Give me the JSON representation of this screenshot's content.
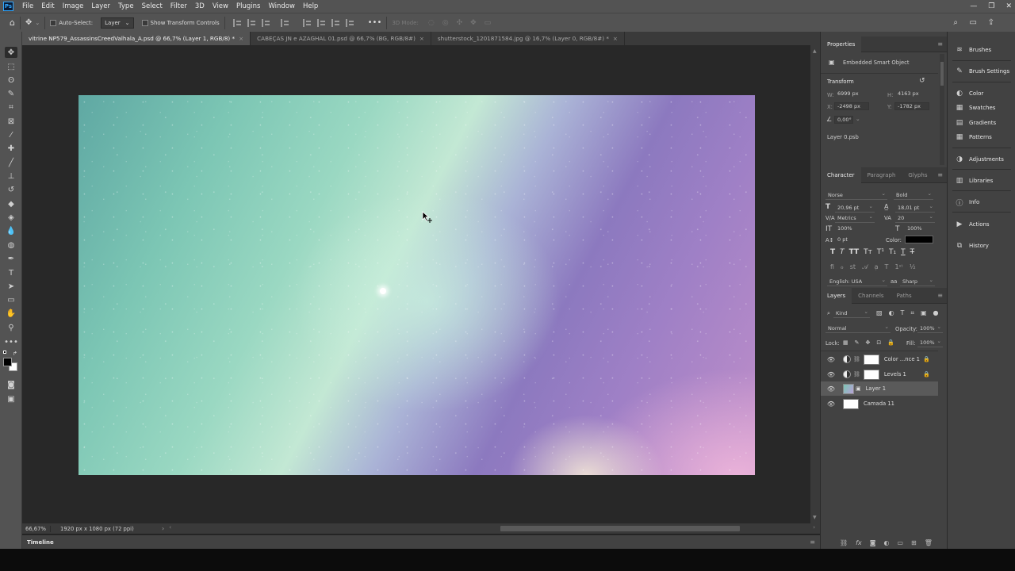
{
  "menubar": {
    "items": [
      "File",
      "Edit",
      "Image",
      "Layer",
      "Type",
      "Select",
      "Filter",
      "3D",
      "View",
      "Plugins",
      "Window",
      "Help"
    ]
  },
  "options": {
    "auto_select_label": "Auto-Select:",
    "auto_select_value": "Layer",
    "show_transform_label": "Show Transform Controls",
    "mode_3d_label": "3D Mode:"
  },
  "tabs": [
    {
      "label": "vitrine NP579_AssassinsCreedValhala_A.psd @ 66,7% (Layer 1, RGB/8) *"
    },
    {
      "label": "CABEÇAS JN e AZAGHAL 01.psd @ 66,7% (BG, RGB/8#)"
    },
    {
      "label": "shutterstock_1201871584.jpg @ 16,7% (Layer 0, RGB/8#) *"
    }
  ],
  "status": {
    "zoom": "66,67%",
    "doc_info": "1920 px x 1080 px (72 ppi)"
  },
  "timeline": {
    "label": "Timeline"
  },
  "properties": {
    "title": "Properties",
    "object_type": "Embedded Smart Object",
    "transform_label": "Transform",
    "w_label": "W:",
    "w_value": "6999 px",
    "h_label": "H:",
    "h_value": "4163 px",
    "x_label": "X:",
    "x_value": "-2498 px",
    "y_label": "Y:",
    "y_value": "-1782 px",
    "angle_value": "0,00°",
    "linked_file": "Layer 0.psb"
  },
  "character": {
    "tabs": [
      "Character",
      "Paragraph",
      "Glyphs"
    ],
    "font_family": "Norse",
    "font_style": "Bold",
    "font_size": "20,96 pt",
    "leading": "18,01 pt",
    "kerning": "Metrics",
    "tracking": "20",
    "vscale": "100%",
    "hscale": "100%",
    "baseline": "0 pt",
    "color_label": "Color:",
    "color_value": "#000000",
    "language": "English: USA",
    "antialias": "Sharp",
    "aa_label": "aa"
  },
  "layers_panel": {
    "tabs": [
      "Layers",
      "Channels",
      "Paths"
    ],
    "filter_kind": "Kind",
    "blend_mode": "Normal",
    "opacity_label": "Opacity:",
    "opacity_value": "100%",
    "lock_label": "Lock:",
    "fill_label": "Fill:",
    "fill_value": "100%",
    "layers": [
      {
        "name": "Color ...nce 1"
      },
      {
        "name": "Levels 1"
      },
      {
        "name": "Layer 1"
      },
      {
        "name": "Camada 11"
      }
    ]
  },
  "side_panels": [
    "Brushes",
    "Brush Settings",
    "Color",
    "Swatches",
    "Gradients",
    "Patterns",
    "Adjustments",
    "Libraries",
    "Info",
    "Actions",
    "History"
  ],
  "colors": {
    "ui_dark": "#535353",
    "panel": "#424242",
    "workspace": "#282828",
    "accent_ps": "#31a8ff"
  }
}
